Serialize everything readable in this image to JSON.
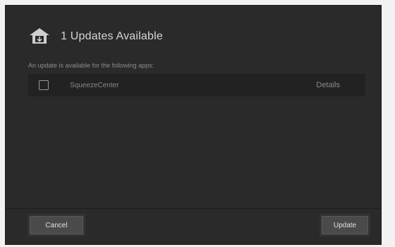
{
  "dialog": {
    "title": "1 Updates Available",
    "subtitle": "An update is available for the following apps:",
    "header_icon": "house-download-icon"
  },
  "apps": [
    {
      "name": "SqueezeCenter",
      "checked": false,
      "details_label": "Details"
    }
  ],
  "footer": {
    "cancel_label": "Cancel",
    "update_label": "Update"
  },
  "colors": {
    "dialog_bg": "#2a2a2a",
    "row_bg": "#222222",
    "button_bg": "#4a4a4a"
  }
}
